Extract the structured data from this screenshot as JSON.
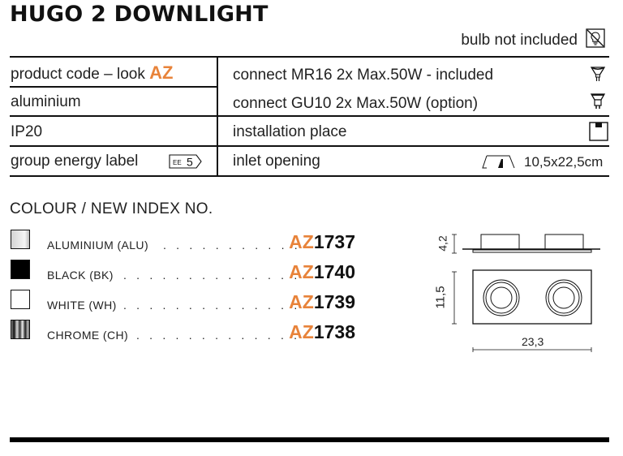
{
  "header": {
    "title": "HUGO 2 DOWNLIGHT",
    "bulb_note": "bulb not included",
    "bulb_note_icon": "bulb-crossed-out-icon"
  },
  "specs": {
    "left": [
      {
        "label": "product code – look",
        "highlight": "AZ"
      },
      {
        "label": "aluminium"
      },
      {
        "label": "IP20"
      },
      {
        "label": "group energy label",
        "badge_prefix": "EE",
        "badge_value": "5"
      }
    ],
    "right": [
      {
        "label": "connect MR16 2x Max.50W - included",
        "icon": "mr16-bulb-icon"
      },
      {
        "label": "connect GU10 2x Max.50W (option)",
        "icon": "gu10-bulb-icon"
      },
      {
        "label": "installation place",
        "icon": "ceiling-mount-icon"
      },
      {
        "label": "inlet opening",
        "icon": "inlet-opening-icon",
        "value": "10,5x22,5cm"
      }
    ]
  },
  "colours": {
    "heading": "COLOUR / NEW INDEX NO.",
    "items": [
      {
        "name": "ALUMINIUM (ALU)",
        "dots": ". . . . . . . . . . .",
        "prefix": "AZ",
        "number": "1737",
        "swatch": "aluminium"
      },
      {
        "name": "BLACK (BK)",
        "dots": ". . . . . . . . . . . . . .",
        "prefix": "AZ",
        "number": "1740",
        "swatch": "black"
      },
      {
        "name": "WHITE (WH)",
        "dots": ". . . . . . . . . . . . . .",
        "prefix": "AZ",
        "number": "1739",
        "swatch": "white"
      },
      {
        "name": "CHROME (CH)",
        "dots": ". . . . . . . . . . . . .",
        "prefix": "AZ",
        "number": "1738",
        "swatch": "chrome"
      }
    ]
  },
  "drawing": {
    "height_label": "4,2",
    "depth_label": "11,5",
    "width_label": "23,3"
  },
  "colors": {
    "accent": "#E8833A",
    "text": "#222222",
    "line": "#111111"
  }
}
